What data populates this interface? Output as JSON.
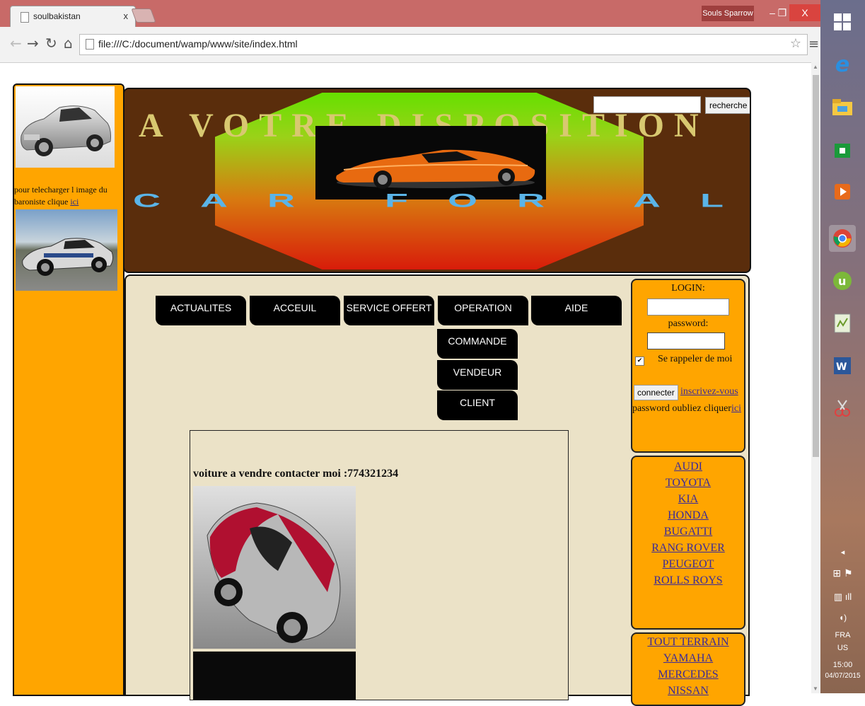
{
  "browser": {
    "tab_title": "soulbakistan",
    "tab_close": "x",
    "user_name": "Souls Sparrow",
    "url": "file:///C:/document/wamp/www/site/index.html"
  },
  "window_controls": {
    "minimize": "–",
    "restore": "❐",
    "close": "X"
  },
  "banner": {
    "title": "A VOTRE DISPOSITION",
    "subtitle": "CAR FOR ALL",
    "search_button": "recherche"
  },
  "sidebar": {
    "text": "pour telecharger l image du baroniste clique ",
    "link": "ici"
  },
  "nav": {
    "items": [
      "ACTUALITES",
      "ACCEUIL",
      "SERVICE OFFERT",
      "OPERATION",
      "AIDE"
    ],
    "sub_items": [
      "COMMANDE",
      "VENDEUR",
      "CLIENT"
    ]
  },
  "content": {
    "title": "voiture a vendre contacter moi :774321234"
  },
  "login": {
    "login_label": "LOGIN:",
    "password_label": "password:",
    "remember_label": "Se rappeler de moi",
    "remember_checked": true,
    "connect_button": "connecter",
    "signup_link": "inscrivez-vous",
    "forgot_text": "password oubliez cliquer",
    "forgot_link": "ici"
  },
  "brands": [
    "AUDI",
    "TOYOTA",
    "KIA",
    "HONDA",
    "BUGATTI",
    "RANG ROVER",
    "PEUGEOT",
    "ROLLS ROYS"
  ],
  "brands2": [
    "TOUT TERRAIN",
    "YAMAHA",
    "MERCEDES",
    "NISSAN"
  ],
  "taskbar": {
    "lang": "FRA",
    "region": "US",
    "time": "15:00",
    "date": "04/07/2015"
  }
}
